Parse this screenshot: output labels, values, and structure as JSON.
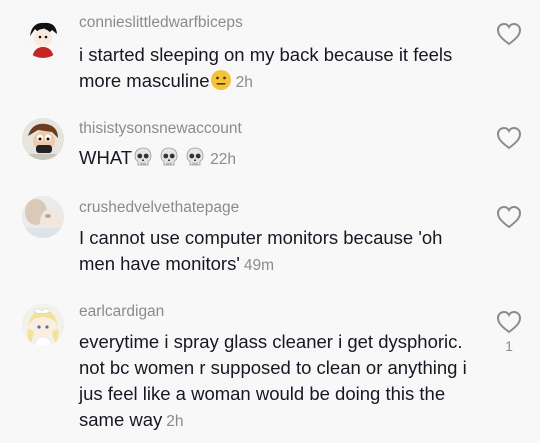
{
  "comments": [
    {
      "username": "connieslittledwarfbiceps",
      "text": "i started sleeping on my back because it feels more masculine",
      "emoji": "neutral-face-emoji",
      "time": "2h",
      "likes": ""
    },
    {
      "username": "thisistysonsnewaccount",
      "text": "WHAT",
      "emoji": "skull-emoji x3",
      "time": "22h",
      "likes": ""
    },
    {
      "username": "crushedvelvethatepage",
      "text": "I cannot use computer monitors because 'oh men have monitors'",
      "emoji": "",
      "time": "49m",
      "likes": ""
    },
    {
      "username": "earlcardigan",
      "text": "everytime i spray glass cleaner i get dysphoric. not bc women r supposed to clean or anything i jus feel like a woman would be doing this the same way",
      "emoji": "",
      "time": "2h",
      "likes": "1"
    }
  ]
}
